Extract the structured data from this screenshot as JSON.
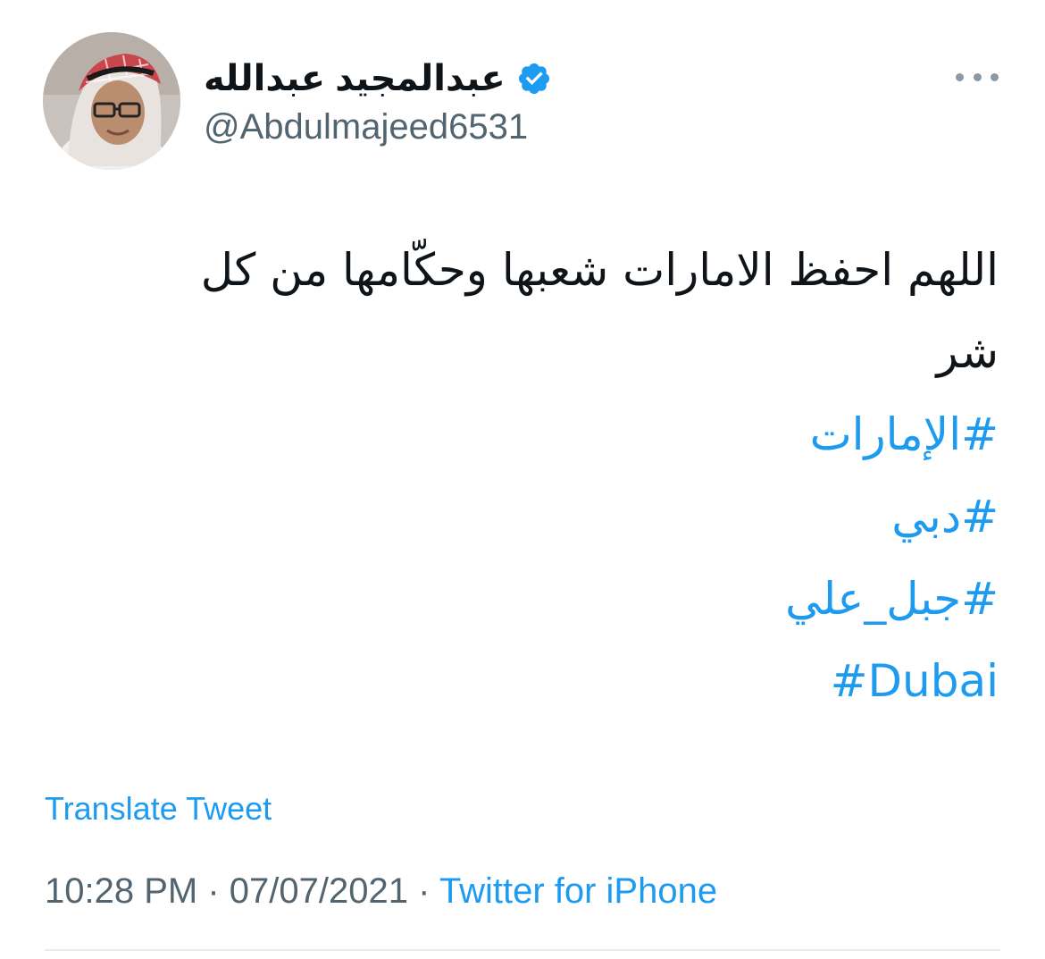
{
  "author": {
    "display_name": "عبدالمجيد عبدالله",
    "handle": "@Abdulmajeed6531",
    "verified_icon": "verified-badge-icon",
    "avatar_icon": "profile-photo"
  },
  "tweet": {
    "text_line1": "اللهم احفظ الامارات شعبها وحكّامها من كل",
    "text_line2": "شر",
    "hashtags": [
      "#الإمارات",
      "#دبي",
      "#جبل_علي",
      "#Dubai"
    ]
  },
  "actions": {
    "translate_label": "Translate Tweet",
    "more_icon": "more-options-icon"
  },
  "meta": {
    "time": "10:28 PM",
    "separator": "·",
    "date": "07/07/2021",
    "source": "Twitter for iPhone"
  },
  "colors": {
    "link": "#1d9bf0",
    "secondary": "#536471",
    "text": "#0f1419"
  }
}
